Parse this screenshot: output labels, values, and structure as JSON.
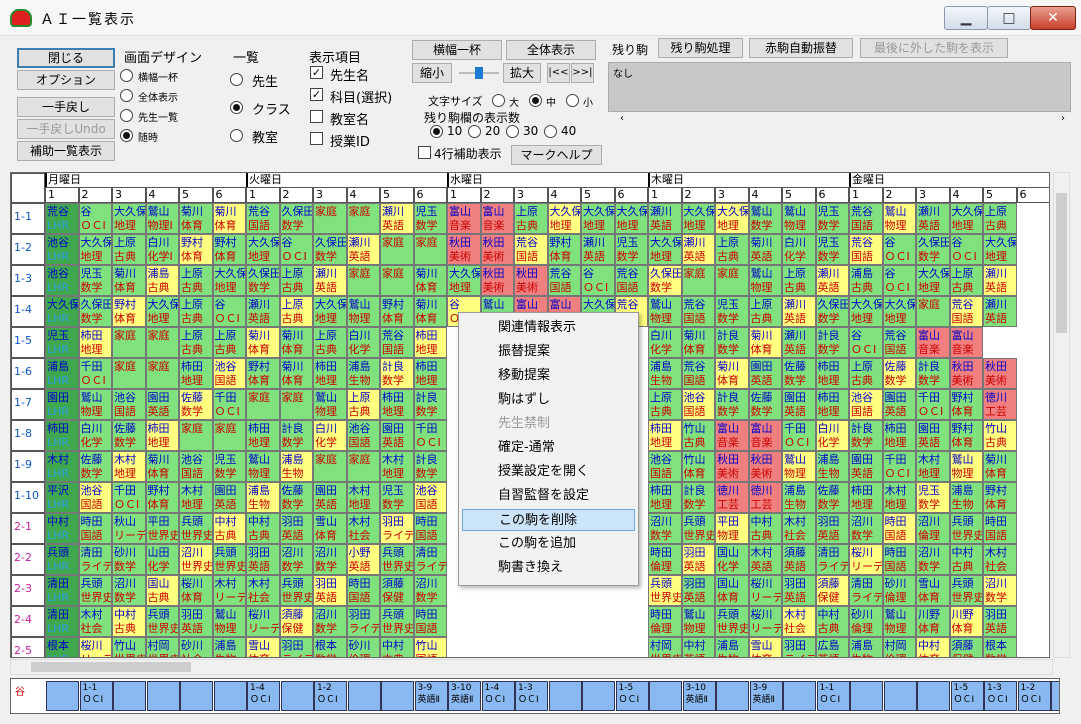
{
  "window": {
    "title": "ＡＩ一覧表示"
  },
  "left_buttons": {
    "close": "閉じる",
    "options": "オプション",
    "undo": "一手戻し",
    "undo_undo": "一手戻しUndo",
    "aux_list": "補助一覧表示"
  },
  "screen_design": {
    "title": "画面デザイン",
    "options": [
      "横幅一杯",
      "全体表示",
      "先生一覧",
      "随時"
    ],
    "selected": 3
  },
  "list": {
    "title": "一覧",
    "options": [
      "先生",
      "クラス",
      "教室"
    ],
    "selected": 1
  },
  "display_items": {
    "title": "表示項目",
    "options": [
      {
        "label": "先生名",
        "checked": true
      },
      {
        "label": "科目(選択)",
        "checked": true
      },
      {
        "label": "教室名",
        "checked": false
      },
      {
        "label": "授業ID",
        "checked": false
      }
    ]
  },
  "zoom": {
    "full_width": "横幅一杯",
    "whole": "全体表示",
    "shrink": "縮小",
    "enlarge": "拡大",
    "prev": "|<<",
    "next": ">>|"
  },
  "font_size": {
    "title": "文字サイズ",
    "options": [
      "大",
      "中",
      "小"
    ],
    "selected": 1
  },
  "remaining_rows": {
    "title": "残り駒欄の表示数",
    "options": [
      "10",
      "20",
      "30",
      "40"
    ],
    "selected": 0
  },
  "four_rows": {
    "label": "4行補助表示",
    "checked": false
  },
  "mark_help": "マークヘルプ",
  "remaining": {
    "title": "残り駒",
    "process": "残り駒処理",
    "auto": "赤駒自動振替",
    "last_removed": "最後に外した駒を表示",
    "message": "なし"
  },
  "grid": {
    "days": [
      "月曜日",
      "火曜日",
      "水曜日",
      "木曜日",
      "金曜日"
    ],
    "periods": [
      "1",
      "2",
      "3",
      "4",
      "5",
      "6"
    ],
    "classes": [
      "1-1",
      "1-2",
      "1-3",
      "1-4",
      "1-5",
      "1-6",
      "1-7",
      "1-8",
      "1-9",
      "1-10",
      "2-1",
      "2-2",
      "2-3",
      "2-4",
      "2-5"
    ],
    "cells": [
      [
        "荒谷|LHR",
        "谷|ＯＣⅠ",
        "大久保|地理",
        "鷲山|物理Ⅰ",
        "菊川|体育",
        "菊川|体育",
        "荒谷|国語",
        "久保田|数学",
        "|家庭",
        "|家庭",
        "瀬川|英語",
        "児玉|数学",
        "富山|音楽",
        "富山|音楽",
        "上原|古典",
        "大久保|地理",
        "大久保|地理",
        "大久保|地理",
        "瀬川|英語",
        "大久保|地理",
        "大久保|地理",
        "鷲山|数学",
        "鷲山|物理",
        "児玉|数学",
        "荒谷|国語",
        "鷲山|物理",
        "瀬川|英語",
        "大久保|地理",
        "上原|古典"
      ],
      [
        "池谷|LHR",
        "大久保|地理",
        "上原|古典",
        "白川|化学Ⅰ",
        "野村|体育",
        "野村|体育",
        "大久保|地理",
        "谷|ＯＣⅠ",
        "久保田|数学",
        "瀬川|英語",
        "|家庭",
        "|家庭",
        "秋田|美術",
        "秋田|美術",
        "荒谷|国語",
        "野村|体育",
        "瀬川|英語",
        "児玉|数学",
        "大久保|地理",
        "瀬川|英語",
        "上原|古典",
        "菊川|英語",
        "白川|化学",
        "児玉|数学",
        "荒谷|国語",
        "谷|ＯＣⅠ",
        "久保田|数学",
        "谷|ＯＣⅠ",
        "大久保|地理"
      ],
      [
        "池谷|LHR",
        "児玉|数学",
        "菊川|体育",
        "浦島|古典",
        "上原|古典",
        "大久保|地理",
        "久保田|数学",
        "上原|古典",
        "瀬川|英語",
        "|家庭",
        "|家庭",
        "菊川|体育",
        "大久保|地理",
        "秋田|美術",
        "秋田|美術",
        "荒谷|国語",
        "谷|ＯＣⅠ",
        "荒谷|国語",
        "久保田|数学",
        "|家庭",
        "|家庭",
        "鷲山|物理",
        "上原|古典",
        "瀬川|英語",
        "浦島|古典",
        "谷|ＯＣⅠ",
        "大久保|地理",
        "上原|古典",
        "瀬川|英語"
      ],
      [
        "大久保|LHR",
        "久保田|数学",
        "野村|体育",
        "大久保|地理",
        "上原|古典",
        "谷|ＯＣⅠ",
        "瀬川|英語",
        "上原|古典",
        "大久保|地理",
        "鷲山|物理",
        "野村|体育",
        "菊川|体育",
        "谷|ＯＣⅠ",
        "鷲山|物理",
        "富山|音楽",
        "富山|音楽",
        "大久保|地理",
        "荒谷|国語",
        "鷲山|物理",
        "荒谷|国語",
        "児玉|数学",
        "上原|古典",
        "瀬川|英語",
        "久保田|数学",
        "大久保|地理",
        "大久保|地理",
        "|家庭",
        "荒谷|国語",
        "瀬川|英語"
      ],
      [
        "児玉|LHR",
        "柿田|地理",
        "|家庭",
        "|家庭",
        "上原|古典",
        "上原|古典",
        "菊川|体育",
        "菊川|体育",
        "上原|古典",
        "白川|化学",
        "荒谷|国語",
        "柿田|地理",
        "",
        "",
        "",
        "",
        "",
        "",
        "白川|化学",
        "菊川|体育",
        "計良|数学",
        "菊川|体育",
        "瀬川|英語",
        "計良|数学",
        "谷|ＯＣⅠ",
        "荒谷|国語",
        "富山|音楽",
        "富山|音楽"
      ],
      [
        "浦島|LHR",
        "千田|ＯＣⅠ",
        "|家庭",
        "|家庭",
        "柿田|地理",
        "池谷|国語",
        "野村|体育",
        "菊川|体育",
        "柿田|地理",
        "浦島|生物",
        "計良|数学",
        "柿田|地理",
        "",
        "",
        "",
        "",
        "",
        "",
        "浦島|生物",
        "荒谷|国語",
        "菊川|体育",
        "園田|英語",
        "佐藤|数学",
        "柿田|地理",
        "上原|古典",
        "佐藤|数学",
        "計良|数学",
        "秋田|美術",
        "秋田|美術"
      ],
      [
        "園田|LHR",
        "鷲山|物理",
        "池谷|国語",
        "園田|英語",
        "佐藤|数学",
        "千田|ＯＣⅠ",
        "|家庭",
        "|家庭",
        "鷲山|物理",
        "上原|古典",
        "柿田|地理",
        "計良|数学",
        "",
        "",
        "",
        "",
        "",
        "",
        "上原|古典",
        "池谷|国語",
        "計良|数学",
        "佐藤|数学",
        "園田|英語",
        "柿田|地理",
        "池谷|国語",
        "園田|英語",
        "千田|ＯＣⅠ",
        "野村|体育",
        "徳川|工芸"
      ],
      [
        "柿田|LHR",
        "白川|化学",
        "佐藤|数学",
        "柿田|地理",
        "|家庭",
        "|家庭",
        "柿田|地理",
        "計良|数学",
        "白川|化学",
        "池谷|国語",
        "園田|英語",
        "千田|ＯＣⅠ",
        "",
        "",
        "",
        "",
        "",
        "",
        "柿田|地理",
        "竹山|古典",
        "富山|音楽",
        "富山|音楽",
        "千田|ＯＣⅠ",
        "白川|化学",
        "計良|数学",
        "柿田|地理",
        "園田|英語",
        "野村|体育",
        "竹山|古典"
      ],
      [
        "木村|LHR",
        "佐藤|数学",
        "木村|地理",
        "菊川|体育",
        "池谷|国語",
        "児玉|数学",
        "鷲山|物理",
        "浦島|生物",
        "|家庭",
        "|家庭",
        "木村|地理",
        "計良|数学",
        "",
        "",
        "",
        "",
        "",
        "",
        "池谷|国語",
        "竹山|体育",
        "秋田|美術",
        "秋田|美術",
        "鷲山|物理",
        "浦島|生物",
        "園田|英語",
        "千田|ＯＣⅠ",
        "木村|地理",
        "鷲山|物理",
        "菊川|体育"
      ],
      [
        "平沢|LHR",
        "池谷|国語",
        "千田|ＯＣⅠ",
        "野村|体育",
        "木村|地理",
        "園田|英語",
        "浦島|生物",
        "佐藤|数学",
        "園田|英語",
        "木村|地理",
        "児玉|数学",
        "池谷|国語",
        "",
        "",
        "",
        "",
        "",
        "",
        "柿田|地理",
        "計良|数学",
        "徳川|工芸",
        "徳川|工芸",
        "浦島|生物",
        "佐藤|数学",
        "柿田|地理",
        "木村|地理",
        "児玉|数学",
        "浦島|生物",
        "野村|体育"
      ],
      [
        "中村|LHR",
        "時田|国語",
        "秋山|リーデ",
        "平田|世界史",
        "兵頭|世界史",
        "中村|古典",
        "中村|古典",
        "羽田|英語",
        "雪山|体育",
        "木村|社会",
        "羽田|ライテ",
        "時田|国語",
        "",
        "",
        "",
        "",
        "",
        "",
        "沼川|数学",
        "兵頭|世界史",
        "平田|物理",
        "中村|古典",
        "木村|社会",
        "羽田|英語",
        "沼川|数学",
        "時田|国語",
        "沼川|倫理",
        "兵頭|世界史",
        "時田|国語"
      ],
      [
        "兵頭|LHR",
        "清田|ライテ",
        "砂川|数学",
        "山田|化学",
        "沼川|世界史",
        "兵頭|世界史",
        "羽田|英語",
        "沼川|数学",
        "沼川|数学",
        "小野|英語",
        "兵頭|世界史",
        "清田|ライテ",
        "",
        "",
        "",
        "",
        "",
        "",
        "時田|倫理",
        "羽田|英語",
        "国山|化学",
        "木村|英語",
        "須藤|英語",
        "清田|ライテ",
        "桜川|リーデ",
        "時田|国語",
        "沼川|数学",
        "中村|古典",
        "木村|社会"
      ],
      [
        "清田|LHR",
        "兵頭|世界史",
        "沼川|数学",
        "国山|古典",
        "桜川|体育",
        "木村|リーデ",
        "木村|社会",
        "兵頭|世界史",
        "羽田|英語",
        "時田|国語",
        "須藤|保健",
        "沼川|数学",
        "",
        "",
        "",
        "",
        "",
        "",
        "兵頭|世界史",
        "羽田|英語",
        "国山|体育",
        "桜川|リーデ",
        "羽田|英語",
        "須藤|保健",
        "清田|ライテ",
        "砂川|倫理",
        "雪山|体育",
        "兵頭|世界史",
        "沼川|数学"
      ],
      [
        "清田|LHR",
        "木村|社会",
        "中村|古典",
        "兵頭|世界史",
        "羽田|英語",
        "鷲山|物理",
        "桜川|リーデ",
        "須藤|保健",
        "沼川|数学",
        "羽田|ライテ",
        "兵頭|世界史",
        "時田|国語",
        "",
        "",
        "",
        "",
        "",
        "",
        "時田|倫理",
        "鷲山|物理",
        "兵頭|世界史",
        "桜川|リーデ",
        "木村|社会",
        "中村|古典",
        "砂川|倫理",
        "鷲山|物理",
        "川野|体育",
        "川野|体育",
        "羽田|英語"
      ],
      [
        "根本|LHR",
        "桜川|リーデ",
        "竹山|世界史",
        "村岡|世界史",
        "砂川|社会",
        "浦島|生物",
        "雪山|体育",
        "羽田|ライテ",
        "根本|数学",
        "砂川|倫理",
        "中村|古典",
        "竹山|国語",
        "",
        "",
        "",
        "",
        "",
        "",
        "村岡|世界史",
        "中村|英語",
        "浦島|生物",
        "雪山|体育",
        "羽田|ライテ",
        "広島|英語",
        "浦島|生物",
        "村岡|倫理",
        "中村|体育",
        "須藤|保健",
        "根本|数学"
      ]
    ]
  },
  "bottom_bar": {
    "teacher": "谷",
    "cells": [
      [
        "",
        ""
      ],
      [
        "1-1",
        "ＯＣⅠ"
      ],
      [
        "",
        ""
      ],
      [
        "",
        ""
      ],
      [
        "",
        ""
      ],
      [
        "",
        ""
      ],
      [
        "1-4",
        "ＯＣⅠ"
      ],
      [
        "",
        ""
      ],
      [
        "1-2",
        "ＯＣⅠ"
      ],
      [
        "",
        ""
      ],
      [
        "",
        ""
      ],
      [
        "3-9",
        "英語Ⅱ"
      ],
      [
        "3-10",
        "英語Ⅱ"
      ],
      [
        "1-4",
        "ＯＣⅠ"
      ],
      [
        "1-3",
        "ＯＣⅠ"
      ],
      [
        "",
        ""
      ],
      [
        "",
        ""
      ],
      [
        "1-5",
        "ＯＣⅠ"
      ],
      [
        "",
        ""
      ],
      [
        "3-10",
        "英語Ⅱ"
      ],
      [
        "",
        ""
      ],
      [
        "3-9",
        "英語Ⅱ"
      ],
      [
        "",
        ""
      ],
      [
        "1-1",
        "ＯＣⅠ"
      ],
      [
        "",
        ""
      ],
      [
        "",
        ""
      ],
      [
        "",
        ""
      ],
      [
        "1-5",
        "ＯＣⅠ"
      ],
      [
        "1-3",
        "ＯＣⅠ"
      ],
      [
        "1-2",
        "ＯＣⅠ"
      ],
      [
        "",
        ""
      ]
    ]
  },
  "context_menu": {
    "items": [
      {
        "label": "関連情報表示"
      },
      {
        "label": "振替提案"
      },
      {
        "label": "移動提案"
      },
      {
        "label": "駒はずし"
      },
      {
        "label": "先生禁制",
        "disabled": true
      },
      {
        "label": "確定-通常"
      },
      {
        "label": "授業設定を開く"
      },
      {
        "label": "自習監督を設定"
      },
      {
        "label": "この駒を削除",
        "highlighted": true
      },
      {
        "label": "この駒を追加"
      },
      {
        "label": "駒書き換え"
      }
    ]
  },
  "colors": {
    "green": "#7fe27f",
    "yellow": "#ffff80",
    "pink": "#f08080",
    "white": "#ffffff",
    "lhr": "#3fa84f"
  }
}
